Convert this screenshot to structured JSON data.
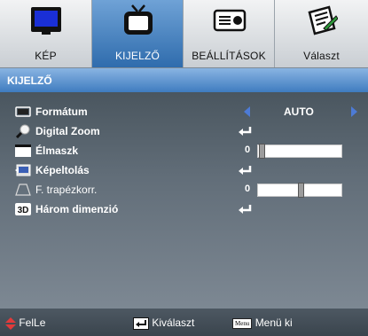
{
  "tabs": [
    {
      "label": "KÉP",
      "icon": "monitor-icon",
      "active": false
    },
    {
      "label": "KIJELZŐ",
      "icon": "tv-icon",
      "active": true
    },
    {
      "label": "BEÁLLÍTÁSOK",
      "icon": "device-icon",
      "active": false
    },
    {
      "label": "Választ",
      "icon": "notepad-icon",
      "active": false
    }
  ],
  "section_title": "KIJELZŐ",
  "menu": {
    "format": {
      "label": "Formátum",
      "value": "AUTO",
      "icon": "screen-icon"
    },
    "digital_zoom": {
      "label": "Digital Zoom",
      "icon": "zoom-icon"
    },
    "edge_mask": {
      "label": "Élmaszk",
      "value": "0",
      "level": 0,
      "icon": "edge-mask-icon"
    },
    "image_shift": {
      "label": "Képeltolás",
      "icon": "image-shift-icon"
    },
    "keystone": {
      "label": "F. trapézkorr.",
      "value": "0",
      "level": 0.5,
      "icon": "trapezoid-icon"
    },
    "three_d": {
      "label": "Három dimenzió",
      "icon": "3d-icon",
      "icon_text": "3D"
    }
  },
  "footer": {
    "updown_label": "FelLe",
    "select_label": "Kiválaszt",
    "menu_key": "Menu",
    "menu_exit_label": "Menü ki"
  },
  "colors": {
    "active_tab": "#3a78bd",
    "title_bar": "#5d93cf",
    "arrow": "#4d7bd6",
    "updown_arrow": "#e23a3a"
  }
}
